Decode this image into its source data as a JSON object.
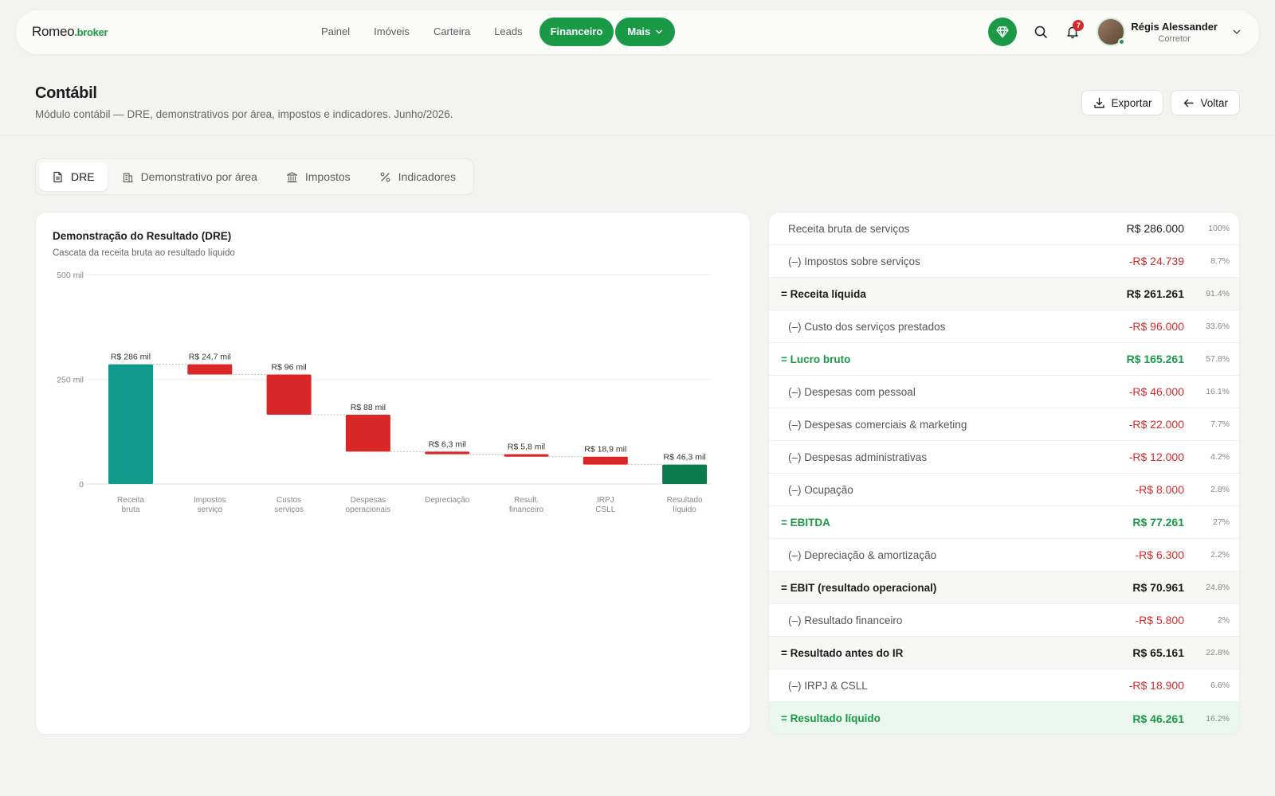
{
  "app": {
    "logo_main": "Romeo",
    "logo_suffix": ".broker"
  },
  "nav": {
    "items": [
      {
        "label": "Painel"
      },
      {
        "label": "Imóveis"
      },
      {
        "label": "Carteira"
      },
      {
        "label": "Leads"
      }
    ],
    "active_label": "Financeiro",
    "more_label": "Mais"
  },
  "user": {
    "name": "Régis Alessander",
    "role": "Corretor",
    "notifications": "7"
  },
  "header": {
    "title": "Contábil",
    "subtitle": "Módulo contábil — DRE, demonstrativos por área, impostos e indicadores. Junho/2026.",
    "export_label": "Exportar",
    "back_label": "Voltar"
  },
  "tabs": [
    {
      "label": "DRE",
      "icon": "document-icon"
    },
    {
      "label": "Demonstrativo por área",
      "icon": "building-icon"
    },
    {
      "label": "Impostos",
      "icon": "bank-icon"
    },
    {
      "label": "Indicadores",
      "icon": "percent-icon"
    }
  ],
  "colors": {
    "accent": "#1a9a46",
    "bar_start": "#119a8c",
    "bar_negative": "#d92727",
    "bar_final": "#0b7a4d"
  },
  "chart_data": {
    "type": "bar",
    "subtype": "waterfall",
    "title": "Demonstração do Resultado (DRE)",
    "subtitle": "Cascata da receita bruta ao resultado líquido",
    "ylim": [
      0,
      500
    ],
    "y_ticks": [
      "0",
      "250 mil",
      "500 mil"
    ],
    "y_tick_values": [
      0,
      250,
      500
    ],
    "grid": true,
    "categories": [
      [
        "Receita",
        "bruta"
      ],
      [
        "Impostos",
        "serviço"
      ],
      [
        "Custos",
        "serviços"
      ],
      [
        "Despesas",
        "operacionais"
      ],
      [
        "Depreciação"
      ],
      [
        "Result.",
        "financeiro"
      ],
      [
        "IRPJ",
        "CSLL"
      ],
      [
        "Resultado",
        "líquido"
      ]
    ],
    "values": [
      286,
      -24.7,
      -96,
      -88,
      -6.3,
      -5.8,
      -18.9,
      46.3
    ],
    "kinds": [
      "start",
      "neg",
      "neg",
      "neg",
      "neg",
      "neg",
      "neg",
      "end"
    ],
    "data_labels": [
      "R$ 286 mil",
      "R$ 24,7 mil",
      "R$ 96 mil",
      "R$ 88 mil",
      "R$ 6,3 mil",
      "R$ 5,8 mil",
      "R$ 18,9 mil",
      "R$ 46,3 mil"
    ]
  },
  "dre_table": [
    {
      "label": "Receita bruta de serviços",
      "value": "R$ 286.000",
      "pct": "100%",
      "style": "normal"
    },
    {
      "label": "(–) Impostos sobre serviços",
      "value": "-R$ 24.739",
      "pct": "8.7%",
      "style": "neg"
    },
    {
      "label": "= Receita líquida",
      "value": "R$ 261.261",
      "pct": "91.4%",
      "style": "total"
    },
    {
      "label": "(–) Custo dos serviços prestados",
      "value": "-R$ 96.000",
      "pct": "33.6%",
      "style": "neg"
    },
    {
      "label": "= Lucro bruto",
      "value": "R$ 165.261",
      "pct": "57.8%",
      "style": "total green"
    },
    {
      "label": "(–) Despesas com pessoal",
      "value": "-R$ 46.000",
      "pct": "16.1%",
      "style": "neg"
    },
    {
      "label": "(–) Despesas comerciais & marketing",
      "value": "-R$ 22.000",
      "pct": "7.7%",
      "style": "neg"
    },
    {
      "label": "(–) Despesas administrativas",
      "value": "-R$ 12.000",
      "pct": "4.2%",
      "style": "neg"
    },
    {
      "label": "(–) Ocupação",
      "value": "-R$ 8.000",
      "pct": "2.8%",
      "style": "neg"
    },
    {
      "label": "= EBITDA",
      "value": "R$ 77.261",
      "pct": "27%",
      "style": "total green"
    },
    {
      "label": "(–) Depreciação & amortização",
      "value": "-R$ 6.300",
      "pct": "2.2%",
      "style": "neg"
    },
    {
      "label": "= EBIT (resultado operacional)",
      "value": "R$ 70.961",
      "pct": "24.8%",
      "style": "total"
    },
    {
      "label": "(–) Resultado financeiro",
      "value": "-R$ 5.800",
      "pct": "2%",
      "style": "neg"
    },
    {
      "label": "= Resultado antes do IR",
      "value": "R$ 65.161",
      "pct": "22.8%",
      "style": "total"
    },
    {
      "label": "(–) IRPJ & CSLL",
      "value": "-R$ 18.900",
      "pct": "6.6%",
      "style": "neg"
    },
    {
      "label": "= Resultado líquido",
      "value": "R$ 46.261",
      "pct": "16.2%",
      "style": "total green final"
    }
  ]
}
